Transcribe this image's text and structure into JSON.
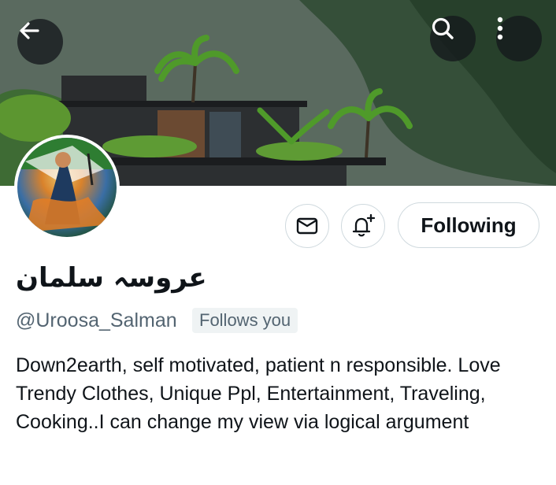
{
  "header": {
    "back_icon": "arrow-left-icon",
    "search_icon": "search-icon",
    "more_icon": "more-vertical-icon"
  },
  "profile": {
    "display_name": "عروسہ سلمان",
    "handle": "@Uroosa_Salman",
    "follows_you": "Follows you",
    "bio": "Down2earth, self motivated, patient n responsible. Love Trendy Clothes, Unique Ppl, Entertainment, Traveling, Cooking..I can change my view via logical argument"
  },
  "actions": {
    "message_icon": "envelope-icon",
    "notify_icon": "bell-plus-icon",
    "following_label": "Following"
  }
}
